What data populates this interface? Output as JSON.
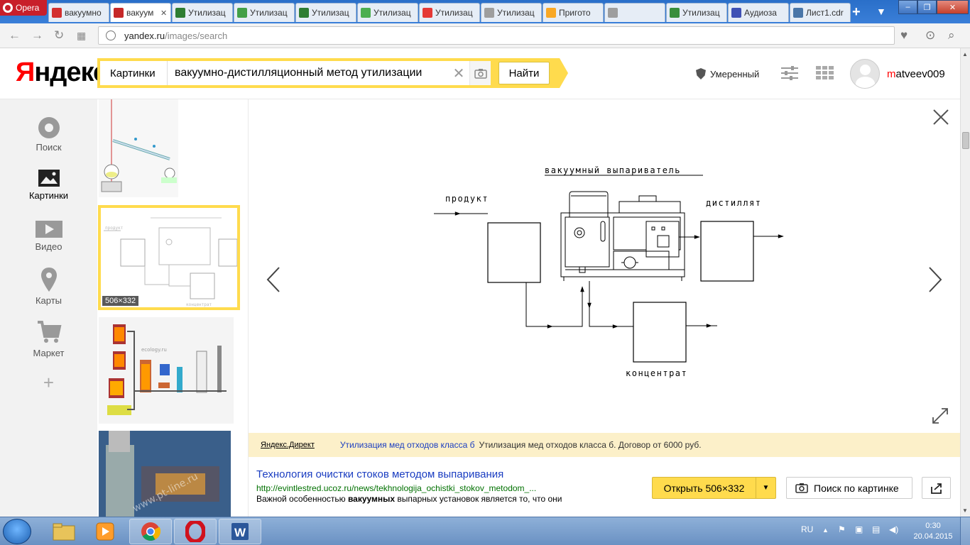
{
  "browser": {
    "menu_label": "Opera",
    "tabs": [
      {
        "title": "вакуумно",
        "favicon": "yandex-icon",
        "color": "#d32f2f"
      },
      {
        "title": "вакуум",
        "favicon": "image-icon",
        "color": "#c62828"
      },
      {
        "title": "Утилизац",
        "favicon": "tree-icon",
        "color": "#2e7d32"
      },
      {
        "title": "Утилизац",
        "favicon": "recycle-icon",
        "color": "#43a047"
      },
      {
        "title": "Утилизац",
        "favicon": "recycle-icon",
        "color": "#2e7d32"
      },
      {
        "title": "Утилизац",
        "favicon": "chart-icon",
        "color": "#4caf50"
      },
      {
        "title": "Утилизац",
        "favicon": "circle-icon",
        "color": "#e53935"
      },
      {
        "title": "Утилизац",
        "favicon": "page-icon",
        "color": "#9e9e9e"
      },
      {
        "title": "Пригото",
        "favicon": "swirl-icon",
        "color": "#f9a825"
      },
      {
        "title": "",
        "favicon": "dash-icon",
        "color": "#9e9e9e"
      },
      {
        "title": "Утилизац",
        "favicon": "recycle-icon",
        "color": "#388e3c"
      },
      {
        "title": "Аудиоза",
        "favicon": "play-icon",
        "color": "#3f51b5"
      },
      {
        "title": "Лист1.cdr",
        "favicon": "vk-icon",
        "color": "#4a76a8"
      }
    ],
    "url_host": "yandex.ru",
    "url_path": "/images/search"
  },
  "yandex": {
    "logo_first": "Я",
    "logo_rest": "ндекс",
    "service_label": "Картинки",
    "query": "вакуумно-дистилляционный метод утилизации",
    "search_button": "Найти",
    "safe_search": "Умеренный",
    "username_first": "m",
    "username_rest": "atveev009"
  },
  "leftnav": [
    {
      "label": "Поиск",
      "icon": "search-circle-icon"
    },
    {
      "label": "Картинки",
      "icon": "picture-icon"
    },
    {
      "label": "Видео",
      "icon": "video-icon"
    },
    {
      "label": "Карты",
      "icon": "map-pin-icon"
    },
    {
      "label": "Маркет",
      "icon": "cart-icon"
    }
  ],
  "thumbs": {
    "selected_size": "506×332"
  },
  "diagram": {
    "title": "вакуумный выпариватель",
    "product": "продукт",
    "distillate": "дистиллят",
    "concentrate": "концентрат"
  },
  "direct": {
    "label": "Яндекс.Директ",
    "link": "Утилизация мед отходов класса б",
    "text": "Утилизация мед отходов класса б. Договор от 6000 руб."
  },
  "result": {
    "title": "Технология очистки стоков методом выпаривания",
    "url": "http://evintlestred.ucoz.ru/news/tekhnologija_ochistki_stokov_metodom_...",
    "desc_before": "Важной особенностью ",
    "desc_bold": "вакуумных",
    "desc_after": " выпарных установок является то, что они",
    "open_button": "Открыть 506×332",
    "search_by_image": "Поиск по картинке"
  },
  "taskbar": {
    "lang": "RU",
    "time": "0:30",
    "date": "20.04.2015"
  }
}
